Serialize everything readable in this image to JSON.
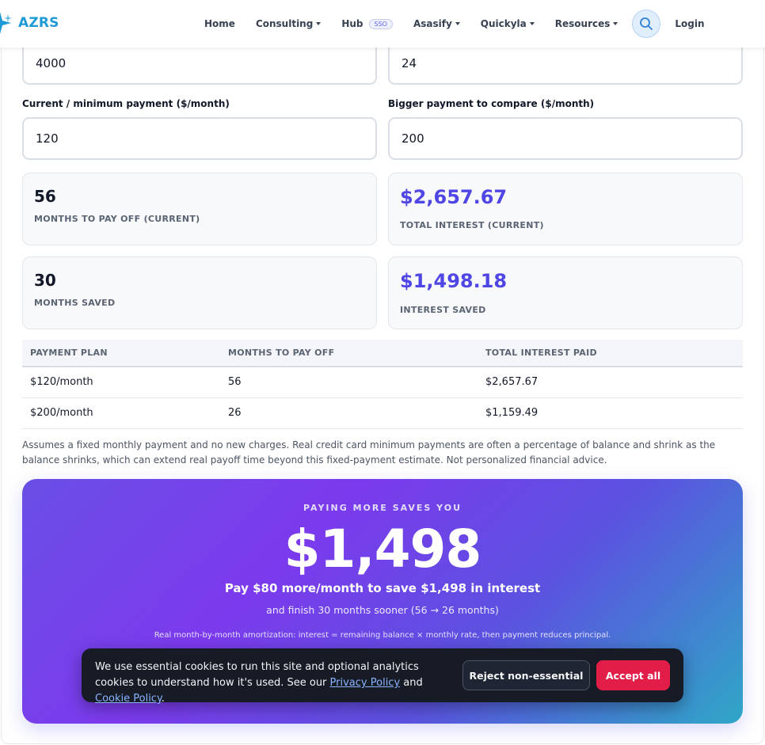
{
  "nav": {
    "brand": "AZRS",
    "items": [
      {
        "label": "Home",
        "dropdown": false
      },
      {
        "label": "Consulting",
        "dropdown": true
      },
      {
        "label": "Hub",
        "badge": "SSO",
        "dropdown": false
      },
      {
        "label": "Asasify",
        "dropdown": true
      },
      {
        "label": "Quickyla",
        "dropdown": true
      },
      {
        "label": "Resources",
        "dropdown": true
      }
    ],
    "search_icon": "search-icon",
    "login": "Login"
  },
  "form": {
    "balance_value": "4000",
    "apr_value": "24",
    "min_payment_label": "Current / minimum payment ($/month)",
    "min_payment_value": "120",
    "bigger_payment_label": "Bigger payment to compare ($/month)",
    "bigger_payment_value": "200"
  },
  "stats": {
    "months_current": {
      "value": "56",
      "label": "MONTHS TO PAY OFF (CURRENT)"
    },
    "interest_current": {
      "value": "$2,657.67",
      "label": "TOTAL INTEREST (CURRENT)"
    },
    "months_saved": {
      "value": "30",
      "label": "MONTHS SAVED"
    },
    "interest_saved": {
      "value": "$1,498.18",
      "label": "INTEREST SAVED"
    }
  },
  "table": {
    "headers": [
      "PAYMENT PLAN",
      "MONTHS TO PAY OFF",
      "TOTAL INTEREST PAID"
    ],
    "rows": [
      [
        "$120/month",
        "56",
        "$2,657.67"
      ],
      [
        "$200/month",
        "26",
        "$1,159.49"
      ]
    ]
  },
  "note": "Assumes a fixed monthly payment and no new charges. Real credit card minimum payments are often a percentage of balance and shrink as the balance shrinks, which can extend real payoff time beyond this fixed-payment estimate. Not personalized financial advice.",
  "promo": {
    "eyebrow": "PAYING MORE SAVES YOU",
    "amount": "$1,498",
    "headline": "Pay $80 more/month to save $1,498 in interest",
    "sub": "and finish 30 months sooner (56 → 26 months)",
    "fine": "Real month-by-month amortization: interest = remaining balance × monthly rate, then payment reduces principal."
  },
  "cookie": {
    "text_before": "We use essential cookies to run this site and optional analytics cookies to understand how it's used. See our ",
    "privacy_link": "Privacy Policy",
    "and": " and ",
    "cookie_link": "Cookie Policy",
    "period": ".",
    "reject": "Reject non-essential",
    "accept": "Accept all"
  },
  "colors": {
    "brand": "#1e9bd7",
    "accent_purple": "#4f46e5",
    "accept_red": "#e11d48"
  }
}
